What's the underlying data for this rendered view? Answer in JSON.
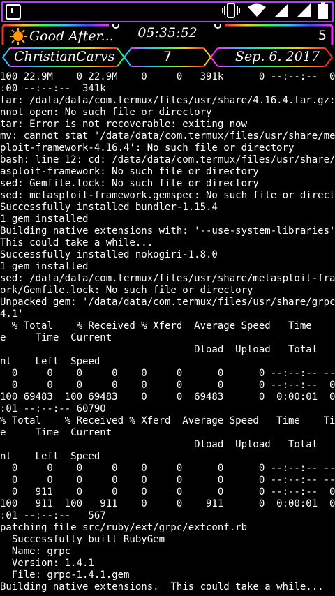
{
  "statusbar": {
    "icons": [
      "notification-icon",
      "vibrate-icon",
      "wifi-icon",
      "signal-icon",
      "signal-icon",
      "battery-icon"
    ]
  },
  "header": {
    "greeting": "Good After...",
    "time": "05:35:52",
    "count": "5",
    "name": "ChristianCarvs",
    "number": "7",
    "date": "Sep. 6. 2017",
    "colors": {
      "rail_start": "#ff2a2a",
      "rail_mid": "#25c8ff",
      "rail_end": "#ff2aff",
      "border": "#b33cff"
    }
  },
  "terminal": {
    "lines": [
      "100 22.9M    0 22.9M    0     0   391k      0 --:--:--  0:01",
      ":00 --:--:--  341k",
      "tar: /data/data/com.termux/files/usr/share/4.16.4.tar.gz: Ca",
      "nnot open: No such file or directory",
      "tar: Error is not recoverable: exiting now",
      "mv: cannot stat '/data/data/com.termux/files/usr/share/metas",
      "ploit-framework-4.16.4': No such file or directory",
      "bash: line 12: cd: /data/data/com.termux/files/usr/share/met",
      "asploit-framework: No such file or directory",
      "sed: Gemfile.lock: No such file or directory",
      "sed: metasploit-framework.gemspec: No such file or directory",
      "Successfully installed bundler-1.15.4",
      "1 gem installed",
      "Building native extensions with: '--use-system-libraries'",
      "This could take a while...",
      "Successfully installed nokogiri-1.8.0",
      "1 gem installed",
      "sed: /data/data/com.termux/files/usr/share/metasploit-framew",
      "ork/Gemfile.lock: No such file or directory",
      "Unpacked gem: '/data/data/com.termux/files/usr/share/grpc-1.",
      "4.1'",
      "  % Total    % Received % Xferd  Average Speed   Time    Tim",
      "e     Time  Current",
      "                                 Dload  Upload   Total   Spe",
      "nt    Left  Speed",
      "  0     0    0     0    0     0      0      0 --:--:-- --:--",
      "  0     0    0     0    0     0      0      0 --:--:--  0:00",
      "100 69483  100 69483    0     0  69483      0  0:00:01  0:00",
      ":01 --:--:-- 60790",
      "% Total    % Received % Xferd  Average Speed   Time    Tim",
      "e     Time  Current",
      "                                 Dload  Upload   Total   Spe",
      "nt    Left  Speed",
      "  0     0    0     0    0     0      0      0 --:--:-- --:--",
      "  0     0    0     0    0     0      0      0 --:--:-- --:--",
      "  0   911    0     0    0     0      0      0 --:--:--  0:00",
      "100   911  100   911    0     0    911      0  0:00:01  0:00",
      ":01 --:--:--   567",
      "patching file src/ruby/ext/grpc/extconf.rb",
      "  Successfully built RubyGem",
      "  Name: grpc",
      "  Version: 1.4.1",
      "  File: grpc-1.4.1.gem",
      "Building native extensions.  This could take a while..."
    ]
  }
}
